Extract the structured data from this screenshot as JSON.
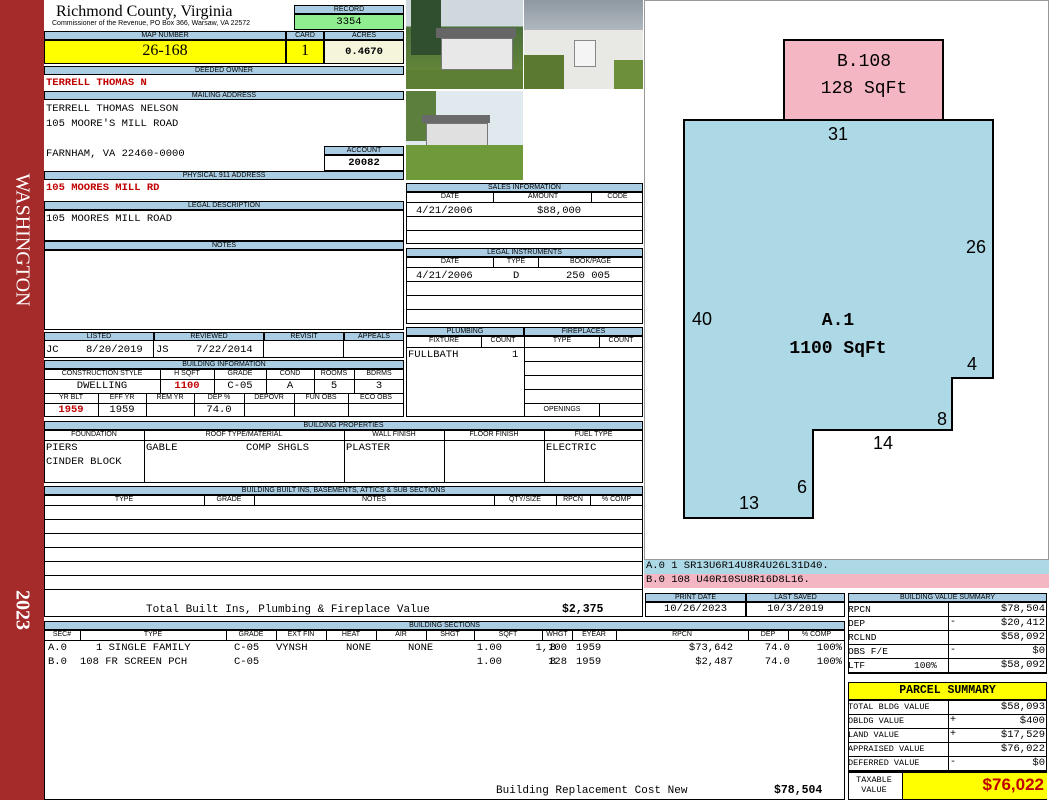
{
  "sidebar": {
    "top_text": "WASHINGTON",
    "bottom_text": "2023",
    "color": "#a52a2a"
  },
  "header": {
    "county": "Richmond County, Virginia",
    "commissioner": "Commissioner of the Revenue, PO Box 366, Warsaw, VA 22572",
    "record_label": "RECORD",
    "record_value": "3354",
    "map_label": "MAP NUMBER",
    "map_value": "26-168",
    "card_label": "CARD",
    "card_value": "1",
    "acres_label": "ACRES",
    "acres_value": "0.4670"
  },
  "owner": {
    "deeded_label": "DEEDED OWNER",
    "deeded_value": "TERRELL THOMAS N",
    "mailing_label": "MAILING ADDRESS",
    "mailing_lines": [
      "TERRELL THOMAS NELSON",
      "105 MOORE'S MILL ROAD",
      "FARNHAM, VA 22460-0000"
    ],
    "account_label": "ACCOUNT",
    "account_value": "20082",
    "physical_label": "PHYSICAL 911 ADDRESS",
    "physical_value": "105 MOORES MILL RD",
    "legal_label": "LEGAL DESCRIPTION",
    "legal_value": "105 MOORES MILL ROAD",
    "notes_label": "NOTES"
  },
  "sales": {
    "title": "SALES INFORMATION",
    "cols": [
      "DATE",
      "AMOUNT",
      "CODE"
    ],
    "rows": [
      {
        "date": "4/21/2006",
        "amount": "$88,000",
        "code": ""
      }
    ]
  },
  "legal_instruments": {
    "title": "LEGAL INSTRUMENTS",
    "cols": [
      "DATE",
      "TYPE",
      "BOOK/PAGE"
    ],
    "rows": [
      {
        "date": "4/21/2006",
        "type": "D",
        "book": "250 005"
      }
    ]
  },
  "listing": {
    "cols": [
      "LISTED",
      "REVIEWED",
      "REVISIT",
      "APPEALS"
    ],
    "listed_by": "JC",
    "listed_date": "8/20/2019",
    "reviewed_by": "JS",
    "reviewed_date": "7/22/2014",
    "revisit": "",
    "appeals": ""
  },
  "building_info": {
    "title": "BUILDING INFORMATION",
    "cols1": [
      "CONSTRUCTION STYLE",
      "H SQFT",
      "GRADE",
      "COND",
      "ROOMS",
      "BDRMS"
    ],
    "vals1": [
      "DWELLING",
      "1100",
      "C-05",
      "A",
      "5",
      "3"
    ],
    "cols2": [
      "YR BLT",
      "EFF YR",
      "REM YR",
      "DEP %",
      "DEPOVR",
      "FUN OBS",
      "ECO OBS"
    ],
    "vals2": [
      "1959",
      "1959",
      "",
      "74.0",
      "",
      "",
      ""
    ]
  },
  "plumbing": {
    "title": "PLUMBING",
    "cols": [
      "FIXTURE",
      "COUNT"
    ],
    "rows": [
      {
        "fixture": "FULLBATH",
        "count": "1"
      }
    ]
  },
  "fireplaces": {
    "title": "FIREPLACES",
    "cols": [
      "TYPE",
      "COUNT"
    ],
    "openings_label": "OPENINGS"
  },
  "building_properties": {
    "title": "BUILDING PROPERTIES",
    "cols": [
      "FOUNDATION",
      "ROOF TYPE/MATERIAL",
      "WALL FINISH",
      "FLOOR FINISH",
      "FUEL TYPE"
    ],
    "foundation": [
      "PIERS",
      "CINDER BLOCK"
    ],
    "roof_type": "GABLE",
    "roof_material": "COMP SHGLS",
    "wall": "PLASTER",
    "floor": "",
    "fuel": "ELECTRIC"
  },
  "builtins": {
    "title": "BUILDING BUILT INS, BASEMENTS, ATTICS & SUB SECTIONS",
    "cols": [
      "TYPE",
      "GRADE",
      "NOTES",
      "QTY/SIZE",
      "RPCN",
      "% COMP"
    ],
    "total_label": "Total Built Ins, Plumbing & Fireplace Value",
    "total_value": "$2,375"
  },
  "sketch": {
    "main_label": "A.1",
    "main_sqft": "1100 SqFt",
    "porch_label": "B.108",
    "porch_sqft": "128 SqFt",
    "dims": [
      "31",
      "26",
      "40",
      "4",
      "8",
      "14",
      "6",
      "13"
    ],
    "main_color": "#add8e6",
    "porch_color": "#f4b6c2",
    "trace_a": "A.0   1    SR13U6R14U8R4U26L31D40.",
    "trace_b": "B.0  108   U40R10SU8R16D8L16."
  },
  "dates": {
    "print_label": "PRINT DATE",
    "print_value": "10/26/2023",
    "saved_label": "LAST SAVED",
    "saved_value": "10/3/2019"
  },
  "building_sections": {
    "title": "BUILDING SECTIONS",
    "cols": [
      "SEC#",
      "TYPE",
      "GRADE",
      "EXT FIN",
      "HEAT",
      "AIR",
      "SHGT",
      "SQFT",
      "WHGT",
      "EYEAR",
      "RPCN",
      "DEP",
      "% COMP"
    ],
    "rows": [
      {
        "sec": "A.0",
        "type": "1 SINGLE FAMILY",
        "grade": "C-05",
        "ext": "VYNSH",
        "heat": "NONE",
        "air": "NONE",
        "shgt": "1.00",
        "sqft": "1,100",
        "whgt": "8",
        "eyear": "1959",
        "rpcn": "$73,642",
        "dep": "74.0",
        "comp": "100%"
      },
      {
        "sec": "B.0",
        "type": "108 FR SCREEN PCH",
        "grade": "C-05",
        "ext": "",
        "heat": "",
        "air": "",
        "shgt": "1.00",
        "sqft": "128",
        "whgt": "8",
        "eyear": "1959",
        "rpcn": "$2,487",
        "dep": "74.0",
        "comp": "100%"
      }
    ],
    "replacement_label": "Building Replacement Cost New",
    "replacement_value": "$78,504"
  },
  "value_summary": {
    "title": "BUILDING VALUE SUMMARY",
    "rows": [
      {
        "label": "RPCN",
        "sign": "",
        "mid": "",
        "value": "$78,504"
      },
      {
        "label": "DEP",
        "sign": "-",
        "mid": "",
        "value": "$20,412"
      },
      {
        "label": "RCLND",
        "sign": "",
        "mid": "",
        "value": "$58,092"
      },
      {
        "label": "OBS F/E",
        "sign": "-",
        "mid": "",
        "value": "$0"
      },
      {
        "label": "LTF",
        "sign": "",
        "mid": "100%",
        "value": "$58,092"
      }
    ]
  },
  "parcel_summary": {
    "title": "PARCEL SUMMARY",
    "rows": [
      {
        "label": "TOTAL BLDG VALUE",
        "sign": "",
        "value": "$58,093"
      },
      {
        "label": "OBLDG VALUE",
        "sign": "+",
        "value": "$400"
      },
      {
        "label": "LAND VALUE",
        "sign": "+",
        "value": "$17,529"
      },
      {
        "label": "APPRAISED VALUE",
        "sign": "",
        "value": "$76,022"
      },
      {
        "label": "DEFERRED VALUE",
        "sign": "-",
        "value": "$0"
      }
    ],
    "taxable_label_1": "TAXABLE",
    "taxable_label_2": "VALUE",
    "taxable_value": "$76,022"
  }
}
